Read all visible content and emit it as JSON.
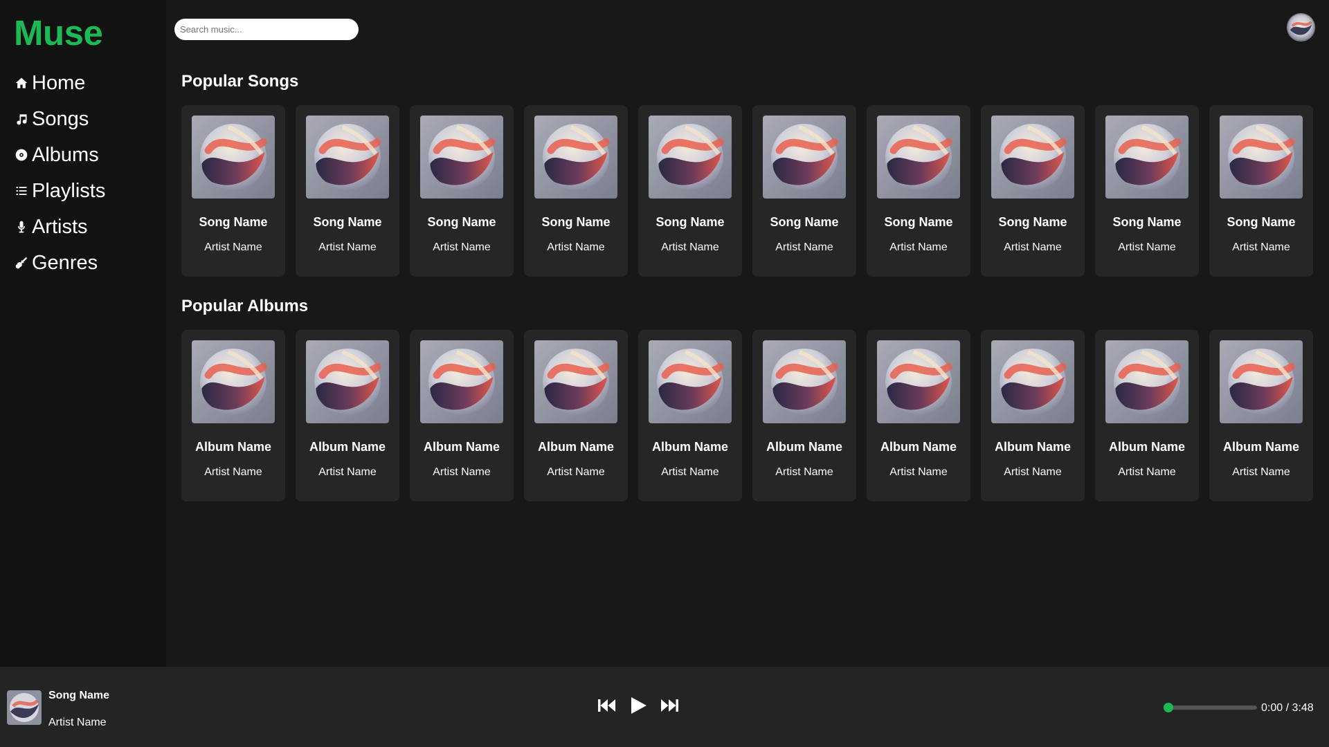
{
  "app": {
    "logo": "Muse",
    "accent_color": "#1db954"
  },
  "sidebar": {
    "items": [
      {
        "label": "Home",
        "icon": "home-icon"
      },
      {
        "label": "Songs",
        "icon": "music-note-icon"
      },
      {
        "label": "Albums",
        "icon": "record-icon"
      },
      {
        "label": "Playlists",
        "icon": "list-icon"
      },
      {
        "label": "Artists",
        "icon": "microphone-icon"
      },
      {
        "label": "Genres",
        "icon": "guitar-icon"
      }
    ]
  },
  "header": {
    "search_placeholder": "Search music..."
  },
  "sections": {
    "songs": {
      "title": "Popular Songs",
      "items": [
        {
          "name": "Song Name",
          "artist": "Artist Name"
        },
        {
          "name": "Song Name",
          "artist": "Artist Name"
        },
        {
          "name": "Song Name",
          "artist": "Artist Name"
        },
        {
          "name": "Song Name",
          "artist": "Artist Name"
        },
        {
          "name": "Song Name",
          "artist": "Artist Name"
        },
        {
          "name": "Song Name",
          "artist": "Artist Name"
        },
        {
          "name": "Song Name",
          "artist": "Artist Name"
        },
        {
          "name": "Song Name",
          "artist": "Artist Name"
        },
        {
          "name": "Song Name",
          "artist": "Artist Name"
        },
        {
          "name": "Song Name",
          "artist": "Artist Name"
        }
      ]
    },
    "albums": {
      "title": "Popular Albums",
      "items": [
        {
          "name": "Album Name",
          "artist": "Artist Name"
        },
        {
          "name": "Album Name",
          "artist": "Artist Name"
        },
        {
          "name": "Album Name",
          "artist": "Artist Name"
        },
        {
          "name": "Album Name",
          "artist": "Artist Name"
        },
        {
          "name": "Album Name",
          "artist": "Artist Name"
        },
        {
          "name": "Album Name",
          "artist": "Artist Name"
        },
        {
          "name": "Album Name",
          "artist": "Artist Name"
        },
        {
          "name": "Album Name",
          "artist": "Artist Name"
        },
        {
          "name": "Album Name",
          "artist": "Artist Name"
        },
        {
          "name": "Album Name",
          "artist": "Artist Name"
        }
      ]
    }
  },
  "player": {
    "title": "Song Name",
    "artist": "Artist Name",
    "time": "0:00 / 3:48",
    "progress": 0
  }
}
